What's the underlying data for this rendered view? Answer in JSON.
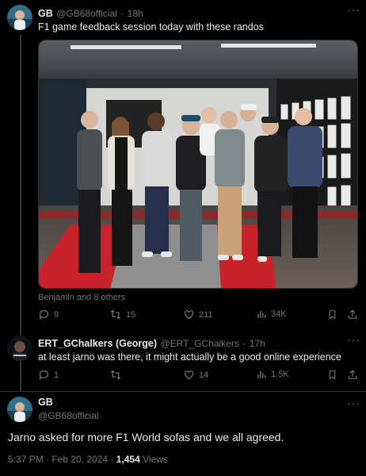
{
  "tweet1": {
    "display_name": "GB",
    "handle": "@GB68official",
    "separator": "·",
    "time": "18h",
    "text": "F1 game feedback session today with these randos",
    "tagged": "Benjamin and 8 others",
    "replies": "9",
    "retweets": "15",
    "likes": "211",
    "views": "34K"
  },
  "reply": {
    "display_name": "ERT_GChalkers (George)",
    "handle": "@ERT_GChalkers",
    "separator": "·",
    "time": "17h",
    "text": "at least jarno was there, it might actually be a good online experience",
    "replies": "1",
    "retweets": "",
    "likes": "14",
    "views": "1.5K"
  },
  "tweet2": {
    "display_name": "GB",
    "handle": "@GB68official",
    "text": "Jarno asked for more F1 World sofas and we all agreed.",
    "timestamp": "5:37 PM · Feb 20, 2024 · ",
    "view_count": "1,454",
    "views_label": " Views"
  },
  "more_icon": "···",
  "colors": {
    "background": "#000000",
    "text": "#e7e9ea",
    "muted": "#71767b",
    "border": "#2f3336"
  }
}
